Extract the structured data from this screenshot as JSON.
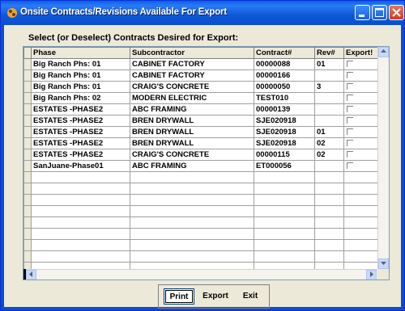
{
  "window": {
    "title": "Onsite Contracts/Revisions Available For Export"
  },
  "prompt": "Select (or Deselect) Contracts Desired for Export:",
  "table": {
    "headers": [
      "Phase",
      "Subcontractor",
      "Contract#",
      "Rev#",
      "Export!"
    ],
    "rows": [
      {
        "phase": "Big Ranch Phs: 01",
        "sub": "CABINET FACTORY",
        "contract": "00000088",
        "rev": "01"
      },
      {
        "phase": "Big Ranch Phs: 01",
        "sub": "CABINET FACTORY",
        "contract": "00000166",
        "rev": ""
      },
      {
        "phase": "Big Ranch Phs: 01",
        "sub": "CRAIG'S CONCRETE",
        "contract": "00000050",
        "rev": "3"
      },
      {
        "phase": "Big Ranch Phs: 02",
        "sub": "MODERN ELECTRIC",
        "contract": "TEST010",
        "rev": ""
      },
      {
        "phase": "ESTATES -PHASE2",
        "sub": "ABC  FRAMING",
        "contract": "00000139",
        "rev": ""
      },
      {
        "phase": "ESTATES -PHASE2",
        "sub": "BREN DRYWALL",
        "contract": "SJE020918",
        "rev": ""
      },
      {
        "phase": "ESTATES -PHASE2",
        "sub": "BREN DRYWALL",
        "contract": "SJE020918",
        "rev": "01"
      },
      {
        "phase": "ESTATES -PHASE2",
        "sub": "BREN DRYWALL",
        "contract": "SJE020918",
        "rev": "02"
      },
      {
        "phase": "ESTATES -PHASE2",
        "sub": "CRAIG'S CONCRETE",
        "contract": "00000115",
        "rev": "02"
      },
      {
        "phase": "SanJuane-Phase01",
        "sub": "ABC  FRAMING",
        "contract": "ET000056",
        "rev": ""
      }
    ]
  },
  "buttons": {
    "print": "Print",
    "export": "Export",
    "exit": "Exit"
  }
}
